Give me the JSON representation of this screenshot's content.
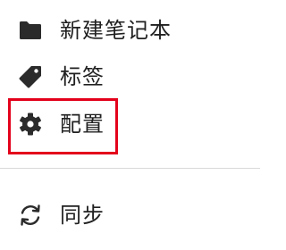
{
  "menu": {
    "items": [
      {
        "id": "new-notebook",
        "label": "新建笔记本",
        "icon": "folder-icon"
      },
      {
        "id": "tags",
        "label": "标签",
        "icon": "tag-icon"
      },
      {
        "id": "settings",
        "label": "配置",
        "icon": "gear-icon"
      },
      {
        "id": "sync",
        "label": "同步",
        "icon": "sync-icon"
      }
    ]
  },
  "colors": {
    "text": "#202020",
    "icon": "#2b2b2b",
    "highlight": "#e3001b",
    "divider": "#d9d9d9"
  }
}
